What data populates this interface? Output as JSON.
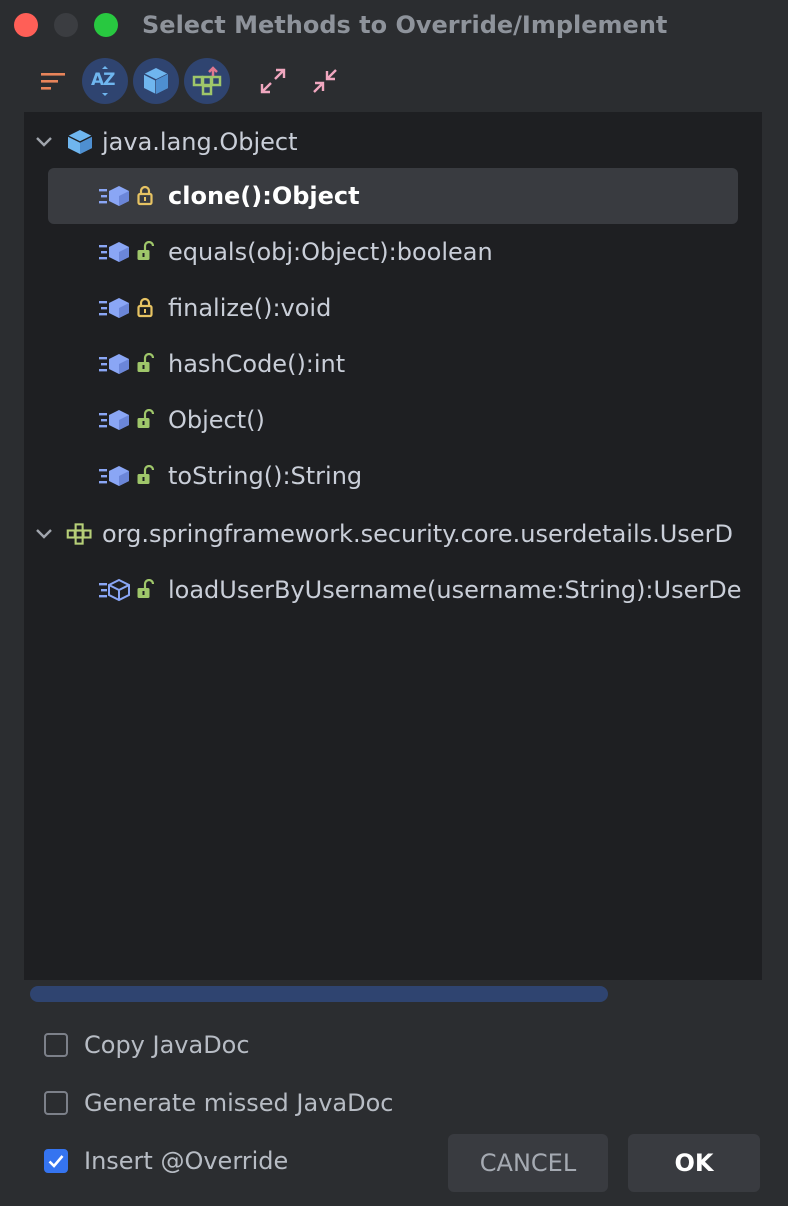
{
  "window": {
    "title": "Select Methods to Override/Implement"
  },
  "toolbar": {
    "buttons": [
      {
        "icon": "sort-icon"
      },
      {
        "icon": "sort-alphabetically-icon",
        "label": "AZ"
      },
      {
        "icon": "class-icon"
      },
      {
        "icon": "show-hierarchy-icon"
      },
      {
        "icon": "expand-all-icon"
      },
      {
        "icon": "collapse-all-icon"
      }
    ]
  },
  "tree": {
    "groups": [
      {
        "label": "java.lang.Object",
        "icon": "class-icon",
        "methods": [
          {
            "label": "clone():Object",
            "lock": "locked",
            "selected": true
          },
          {
            "label": "equals(obj:Object):boolean",
            "lock": "unlocked"
          },
          {
            "label": "finalize():void",
            "lock": "locked"
          },
          {
            "label": "hashCode():int",
            "lock": "unlocked"
          },
          {
            "label": "Object()",
            "lock": "unlocked"
          },
          {
            "label": "toString():String",
            "lock": "unlocked"
          }
        ]
      },
      {
        "label": "org.springframework.security.core.userdetails.UserD",
        "icon": "interface-icon",
        "methods": [
          {
            "label": "loadUserByUsername(username:String):UserDe",
            "lock": "unlocked",
            "abstract": true
          }
        ]
      }
    ]
  },
  "options": {
    "copy_javadoc": {
      "label": "Copy JavaDoc",
      "checked": false
    },
    "generate_missed_javadoc": {
      "label": "Generate missed JavaDoc",
      "checked": false
    },
    "insert_override": {
      "label": "Insert @Override",
      "checked": true
    }
  },
  "buttons": {
    "cancel": "CANCEL",
    "ok": "OK"
  },
  "colors": {
    "accent": "#3574f0",
    "class_icon": "#6fb6ef",
    "method_icon": "#8aa6f5",
    "lock_locked": "#e7c363",
    "lock_unlocked": "#9fc66a"
  }
}
